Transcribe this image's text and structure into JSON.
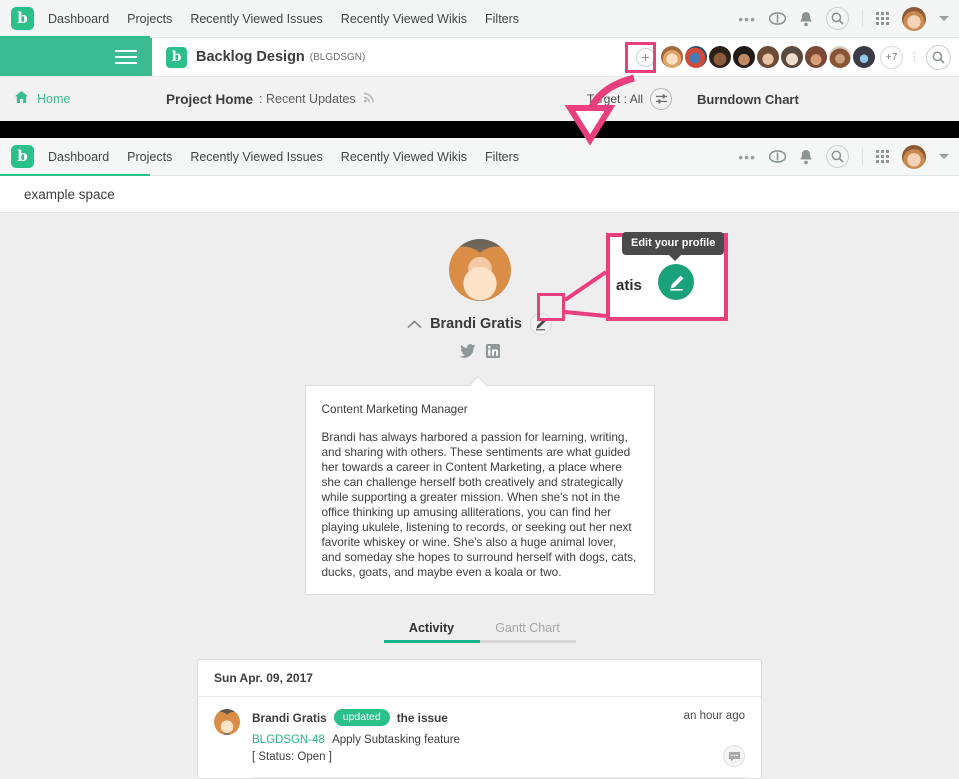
{
  "global_nav_top": {
    "logo": "b",
    "links": [
      "Dashboard",
      "Projects",
      "Recently Viewed Issues",
      "Recently Viewed Wikis",
      "Filters"
    ],
    "icons": [
      "more-dots-icon",
      "eye-icon",
      "bell-icon",
      "search-icon",
      "apps-grid-icon",
      "avatar",
      "caret-down-icon"
    ]
  },
  "project_header": {
    "hamburger": "menu-icon",
    "logo": "b",
    "project_name": "Backlog Design",
    "project_key": "(BLGDSGN)",
    "add_member_label": "+",
    "overflow_members": "+7",
    "search_icon": "search-icon"
  },
  "sub_header": {
    "home_label": "Home",
    "home_icon": "home-icon",
    "page_title": "Project Home",
    "page_subtitle": ": Recent Updates",
    "rss_icon": "rss-icon",
    "target_label": "Target : All",
    "filter_icon": "filter-sliders-icon",
    "chart_label": "Burndown Chart"
  },
  "global_nav_second": {
    "logo": "b",
    "links": [
      "Dashboard",
      "Projects",
      "Recently Viewed Issues",
      "Recently Viewed Wikis",
      "Filters"
    ]
  },
  "space_header": {
    "space_name": "example space"
  },
  "profile": {
    "avatar": "user-avatar",
    "collapse_icon": "chevron-up-icon",
    "name": "Brandi Gratis",
    "edit_icon": "pencil-edit-icon",
    "social": [
      "twitter-icon",
      "linkedin-icon"
    ],
    "job_title": "Content Marketing Manager",
    "bio": "Brandi has always harbored a passion for learning, writing, and sharing with others. These sentiments are what guided her towards a career in Content Marketing, a place where she can challenge herself both creatively and strategically while supporting a greater mission. When she's not in the office thinking up amusing alliterations, you can find her playing ukulele, listening to records, or seeking out her next favorite whiskey or wine. She's also a huge animal lover, and someday she hopes to surround herself with dogs, cats, ducks, goats, and maybe even a koala or two."
  },
  "tabs": {
    "active": "Activity",
    "inactive": "Gantt Chart"
  },
  "activity": {
    "date": "Sun Apr. 09, 2017",
    "items": [
      {
        "user": "Brandi Gratis",
        "badge": "updated",
        "action": "the issue",
        "time": "an hour ago",
        "issue_key": "BLGDSGN-48",
        "issue_summary": "Apply Subtasking feature",
        "status": "[ Status: Open ]",
        "comment_icon": "comment-icon"
      }
    ]
  },
  "annotation": {
    "tooltip_text": "Edit your profile",
    "magnified_name_fragment": "atis",
    "magnified_icon": "pencil-edit-icon",
    "highlight_color": "#ea3e7f"
  },
  "colors": {
    "brand_green": "#2bc08a",
    "header_green": "#3bbb91",
    "accent_pink": "#ea3e7f",
    "link_green": "#2bb189"
  }
}
